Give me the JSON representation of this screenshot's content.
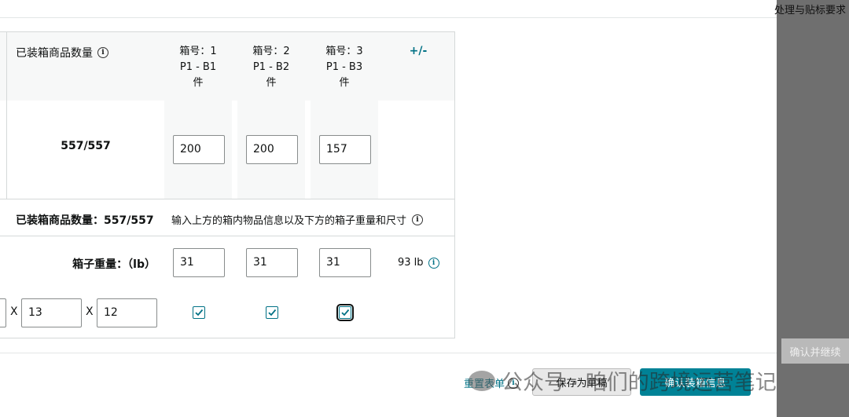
{
  "overlay": {
    "top_text": "处理与贴标要求",
    "continue_button": "确认并继续"
  },
  "table": {
    "header_label": "已装箱商品数量",
    "columns": [
      {
        "box_no": "箱号：1",
        "box_code": "P1 - B1",
        "unit": "件",
        "qty": "200",
        "weight": "31"
      },
      {
        "box_no": "箱号：2",
        "box_code": "P1 - B2",
        "unit": "件",
        "qty": "200",
        "weight": "31"
      },
      {
        "box_no": "箱号：3",
        "box_code": "P1 - B3",
        "unit": "件",
        "qty": "157",
        "weight": "31"
      }
    ],
    "add_remove": "+/-",
    "packed_ratio": "557/557",
    "summary_label": "已装箱商品数量：557/557",
    "summary_hint": "输入上方的箱内物品信息以及下方的箱子重量和尺寸",
    "weight_label": "箱子重量：（lb）",
    "weight_total": "93 lb",
    "dimensions": [
      "13",
      "12"
    ],
    "dim_separator": "X"
  },
  "footer": {
    "reset_link": "重置表单",
    "save_draft": "保存为草稿",
    "confirm": "确认装箱信息"
  },
  "watermark": "公众号 · 咱们的跨境运营笔记",
  "colors": {
    "accent": "#007185",
    "primary_button": "#008296",
    "overlay": "#6f6f6f"
  }
}
